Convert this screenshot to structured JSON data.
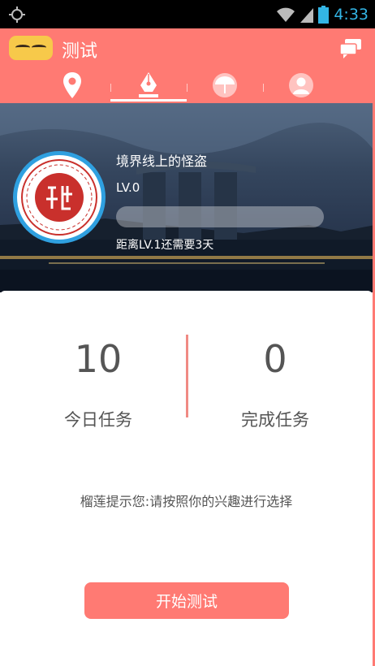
{
  "status_bar": {
    "time": "4:33",
    "icons": [
      "gps-icon",
      "wifi-icon",
      "signal-icon",
      "battery-icon"
    ]
  },
  "header": {
    "title": "测试",
    "tabs": [
      {
        "icon": "location-pin-icon",
        "active": false
      },
      {
        "icon": "pen-nib-icon",
        "active": true
      },
      {
        "icon": "umbrella-icon",
        "active": false
      },
      {
        "icon": "profile-icon",
        "active": false
      }
    ]
  },
  "profile": {
    "name": "境界线上的怪盗",
    "level": "LV.0",
    "progress_fraction": 0,
    "remain_text": "距离LV.1还需要3天"
  },
  "stats": {
    "today_tasks_value": "10",
    "today_tasks_label": "今日任务",
    "completed_tasks_value": "0",
    "completed_tasks_label": "完成任务"
  },
  "hint": "榴莲提示您:请按照你的兴趣进行选择",
  "start_button": "开始测试",
  "colors": {
    "accent": "#ff7a73",
    "status_blue": "#33b5e5",
    "avatar_ring": "#2fa0e0"
  }
}
